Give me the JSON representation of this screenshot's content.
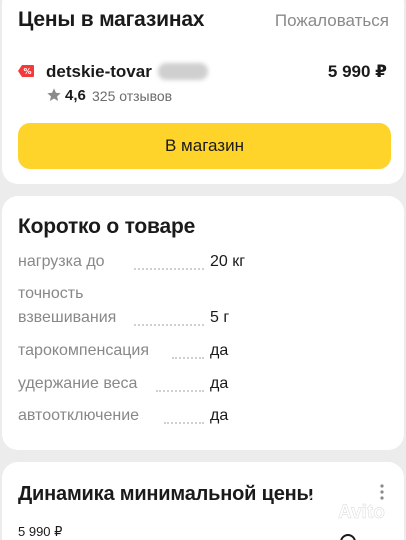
{
  "stores": {
    "title": "Цены в магазинах",
    "complain_label": "Пожаловаться",
    "offer": {
      "shop_name": "detskie-tovar",
      "price": "5 990 ₽",
      "rating": "4,6",
      "reviews": "325 отзывов",
      "logo_icon": "discount-percent-icon",
      "logo_color": "#f33a3a"
    },
    "button_label": "В магазин",
    "button_color": "#fed42b"
  },
  "summary": {
    "title": "Коротко о товаре",
    "specs": [
      {
        "label": "нагрузка до",
        "value": "20 кг"
      },
      {
        "label": "точность взвешивания",
        "value": "5 г"
      },
      {
        "label": "тарокомпенсация",
        "value": "да"
      },
      {
        "label": "удержание веса",
        "value": "да"
      },
      {
        "label": "автоотключение",
        "value": "да"
      }
    ]
  },
  "dynamics": {
    "title": "Динамика минимальной цены",
    "price_label": "5 990 ₽"
  },
  "watermark": {
    "text": "Avito"
  }
}
